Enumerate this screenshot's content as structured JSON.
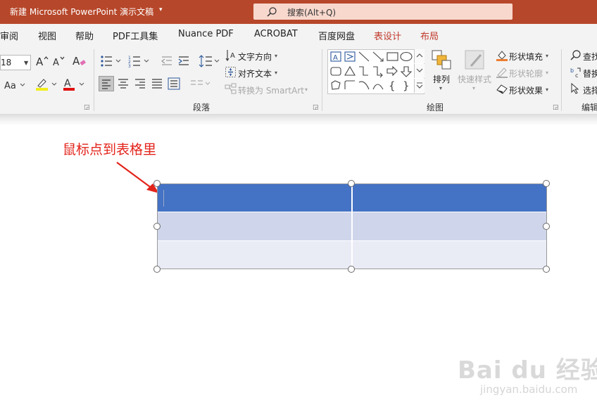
{
  "titlebar": {
    "title": "新建 Microsoft PowerPoint 演示文稿",
    "caret": "▾",
    "search_placeholder": "搜索(Alt+Q)"
  },
  "tabs": [
    {
      "label": "审阅"
    },
    {
      "label": "视图"
    },
    {
      "label": "帮助"
    },
    {
      "label": "PDF工具集"
    },
    {
      "label": "Nuance PDF"
    },
    {
      "label": "ACROBAT"
    },
    {
      "label": "百度网盘"
    },
    {
      "label": "表设计"
    },
    {
      "label": "布局"
    }
  ],
  "ribbon": {
    "font": {
      "size_value": "18"
    },
    "paragraph": {
      "text_direction": "文字方向",
      "align_text": "对齐文本",
      "convert_smartart": "转换为 SmartArt",
      "group_label": "段落"
    },
    "drawing": {
      "arrange": "排列",
      "quick_styles": "快速样式",
      "shape_fill": "形状填充",
      "shape_outline": "形状轮廓",
      "shape_effects": "形状效果",
      "group_label": "绘图"
    },
    "editing": {
      "find": "查找",
      "replace": "替换",
      "select": "选择",
      "group_label": "编辑"
    }
  },
  "colors": {
    "title_bar": "#b7472a",
    "table_header": "#4472c4",
    "table_band": "#cfd5ea",
    "table_band_light": "#e9ebf5",
    "annotation": "#e3241b"
  },
  "slide": {
    "annotation": "鼠标点到表格里",
    "table": {
      "rows": 3,
      "columns": 2
    }
  },
  "watermark": {
    "logo": "Bai du 经验",
    "url": "jingyan.baidu.com"
  }
}
